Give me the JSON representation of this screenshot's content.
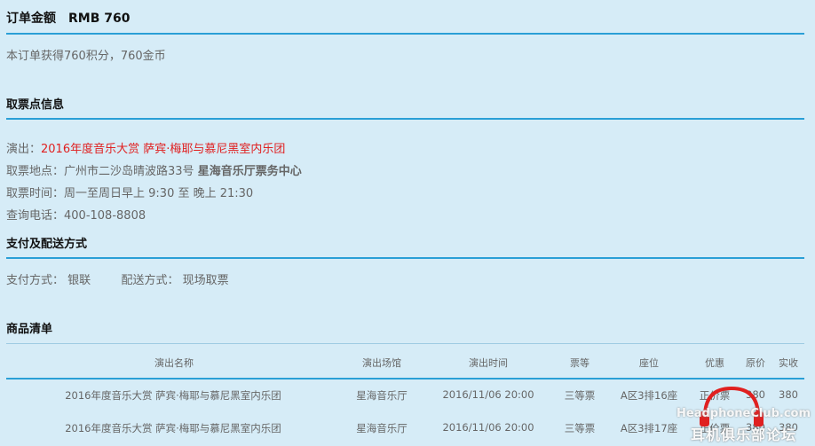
{
  "order_amount": {
    "label": "订单金额",
    "value": "RMB 760"
  },
  "points_note": "本订单获得760积分，760金币",
  "pickup": {
    "title": "取票点信息",
    "show_label": "演出：",
    "show_value": "2016年度音乐大赏 萨宾·梅耶与慕尼黑室内乐团",
    "location_label": "取票地点：",
    "location_value": "广州市二沙岛晴波路33号",
    "location_place": "星海音乐厅票务中心",
    "time_label": "取票时间：",
    "time_value": "周一至周日早上 9:30 至 晚上 21:30",
    "phone_label": "查询电话：",
    "phone_value": "400-108-8808"
  },
  "payment": {
    "title": "支付及配送方式",
    "pay_label": "支付方式：",
    "pay_value": "银联",
    "delivery_label": "配送方式：",
    "delivery_value": "现场取票"
  },
  "items": {
    "title": "商品清单",
    "columns": [
      "演出名称",
      "演出场馆",
      "演出时间",
      "票等",
      "座位",
      "优惠",
      "原价",
      "实收"
    ],
    "rows": [
      [
        "2016年度音乐大赏 萨宾·梅耶与慕尼黑室内乐团",
        "星海音乐厅",
        "2016/11/06 20:00",
        "三等票",
        "A区3排16座",
        "正价票",
        "380",
        "380"
      ],
      [
        "2016年度音乐大赏 萨宾·梅耶与慕尼黑室内乐团",
        "星海音乐厅",
        "2016/11/06 20:00",
        "三等票",
        "A区3排17座",
        "正价票",
        "380",
        "380"
      ]
    ]
  },
  "watermark": {
    "line1": "HeadphoneClub.com",
    "line2": "耳机俱乐部论坛"
  },
  "colors": {
    "background": "#d6ecf7",
    "rule": "#2a9fd6",
    "highlight": "#e02020",
    "watermark_logo": "#e02020"
  }
}
